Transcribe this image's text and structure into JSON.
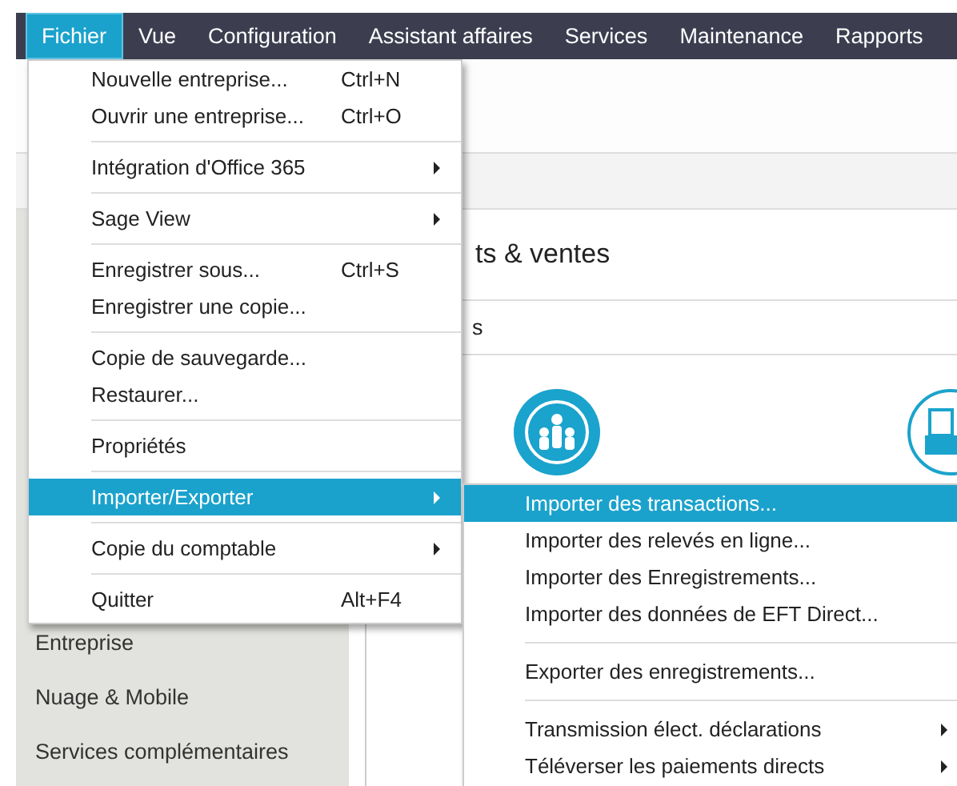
{
  "menubar": [
    {
      "label": "Fichier",
      "selected": true
    },
    {
      "label": "Vue",
      "selected": false
    },
    {
      "label": "Configuration",
      "selected": false
    },
    {
      "label": "Assistant affaires",
      "selected": false
    },
    {
      "label": "Services",
      "selected": false
    },
    {
      "label": "Maintenance",
      "selected": false
    },
    {
      "label": "Rapports",
      "selected": false
    }
  ],
  "sidebar": {
    "items": [
      {
        "label": "Entreprise"
      },
      {
        "label": "Nuage & Mobile"
      },
      {
        "label": "Services complémentaires"
      }
    ]
  },
  "content": {
    "title": "ts & ventes",
    "subtitle": "s"
  },
  "file_menu": [
    {
      "kind": "item",
      "label": "Nouvelle entreprise...",
      "shortcut": "Ctrl+N",
      "submenu": false,
      "selected": false
    },
    {
      "kind": "item",
      "label": "Ouvrir une entreprise...",
      "shortcut": "Ctrl+O",
      "submenu": false,
      "selected": false
    },
    {
      "kind": "separator"
    },
    {
      "kind": "item",
      "label": "Intégration d'Office 365",
      "submenu": true,
      "selected": false
    },
    {
      "kind": "separator"
    },
    {
      "kind": "item",
      "label": "Sage View",
      "submenu": true,
      "selected": false
    },
    {
      "kind": "separator"
    },
    {
      "kind": "item",
      "label": "Enregistrer sous...",
      "shortcut": "Ctrl+S",
      "submenu": false,
      "selected": false
    },
    {
      "kind": "item",
      "label": "Enregistrer une copie...",
      "submenu": false,
      "selected": false
    },
    {
      "kind": "separator"
    },
    {
      "kind": "item",
      "label": "Copie de sauvegarde...",
      "submenu": false,
      "selected": false
    },
    {
      "kind": "item",
      "label": "Restaurer...",
      "submenu": false,
      "selected": false
    },
    {
      "kind": "separator"
    },
    {
      "kind": "item",
      "label": "Propriétés",
      "submenu": false,
      "selected": false
    },
    {
      "kind": "separator"
    },
    {
      "kind": "item",
      "label": "Importer/Exporter",
      "submenu": true,
      "selected": true
    },
    {
      "kind": "separator"
    },
    {
      "kind": "item",
      "label": "Copie du comptable",
      "submenu": true,
      "selected": false
    },
    {
      "kind": "separator"
    },
    {
      "kind": "item",
      "label": "Quitter",
      "shortcut": "Alt+F4",
      "submenu": false,
      "selected": false
    }
  ],
  "import_export_menu": [
    {
      "kind": "item",
      "label": "Importer des transactions...",
      "submenu": false,
      "selected": true
    },
    {
      "kind": "item",
      "label": "Importer des relevés en ligne...",
      "submenu": false,
      "selected": false
    },
    {
      "kind": "item",
      "label": "Importer des Enregistrements...",
      "submenu": false,
      "selected": false
    },
    {
      "kind": "item",
      "label": "Importer des données de EFT Direct...",
      "submenu": false,
      "selected": false
    },
    {
      "kind": "separator"
    },
    {
      "kind": "item",
      "label": "Exporter des enregistrements...",
      "submenu": false,
      "selected": false
    },
    {
      "kind": "separator"
    },
    {
      "kind": "item",
      "label": "Transmission élect. déclarations",
      "submenu": true,
      "selected": false
    },
    {
      "kind": "item",
      "label": "Téléverser les paiements directs",
      "submenu": true,
      "selected": false
    }
  ]
}
